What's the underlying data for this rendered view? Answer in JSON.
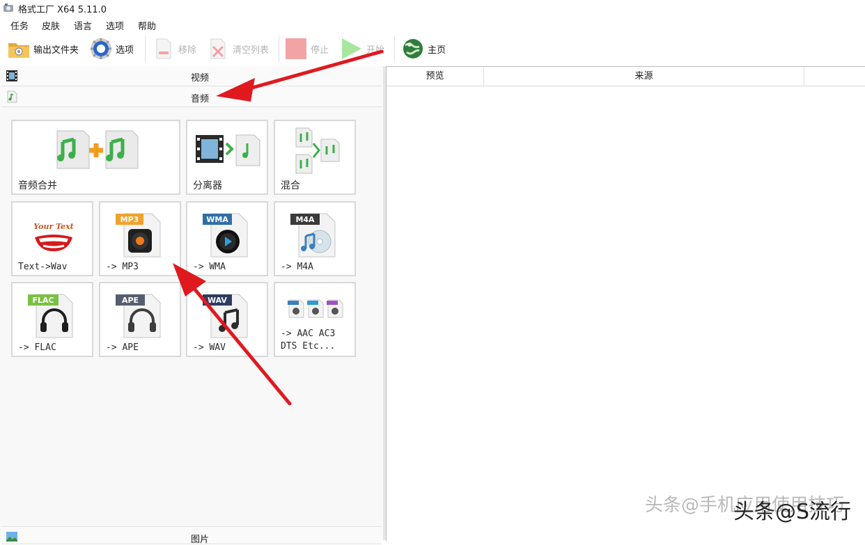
{
  "window": {
    "title": "格式工厂 X64 5.11.0"
  },
  "menu": [
    "任务",
    "皮肤",
    "语言",
    "选项",
    "帮助"
  ],
  "toolbar": {
    "output_folder": "输出文件夹",
    "options": "选项",
    "remove": "移除",
    "clear_list": "清空列表",
    "stop": "停止",
    "start": "开始",
    "home": "主页"
  },
  "categories": {
    "video": "视频",
    "audio": "音频",
    "image": "图片"
  },
  "tiles": [
    {
      "label": "音频合并"
    },
    {
      "label": "分离器"
    },
    {
      "label": "混合"
    },
    {
      "label": "Text->Wav",
      "badge": "Your Text"
    },
    {
      "label": "-> MP3",
      "badge": "MP3"
    },
    {
      "label": "-> WMA",
      "badge": "WMA"
    },
    {
      "label": "-> M4A",
      "badge": "M4A"
    },
    {
      "label": "-> FLAC",
      "badge": "FLAC"
    },
    {
      "label": "-> APE",
      "badge": "APE"
    },
    {
      "label": "-> WAV",
      "badge": "WAV"
    },
    {
      "label": "-> AAC AC3\nDTS Etc..."
    }
  ],
  "list_columns": [
    "预览",
    "来源"
  ],
  "watermark": {
    "dim": "头条@手机应用使用技巧",
    "main": "头条@S流行"
  },
  "colors": {
    "accent_arrow": "#e0191f",
    "disabled_text": "#b3b3b3",
    "mp3_badge": "#f0a22a",
    "wma_badge": "#2f6fa8",
    "m4a_badge": "#3a3a3a",
    "flac_badge": "#7ac143",
    "ape_badge": "#555e6e",
    "wav_badge": "#2e3b63"
  }
}
